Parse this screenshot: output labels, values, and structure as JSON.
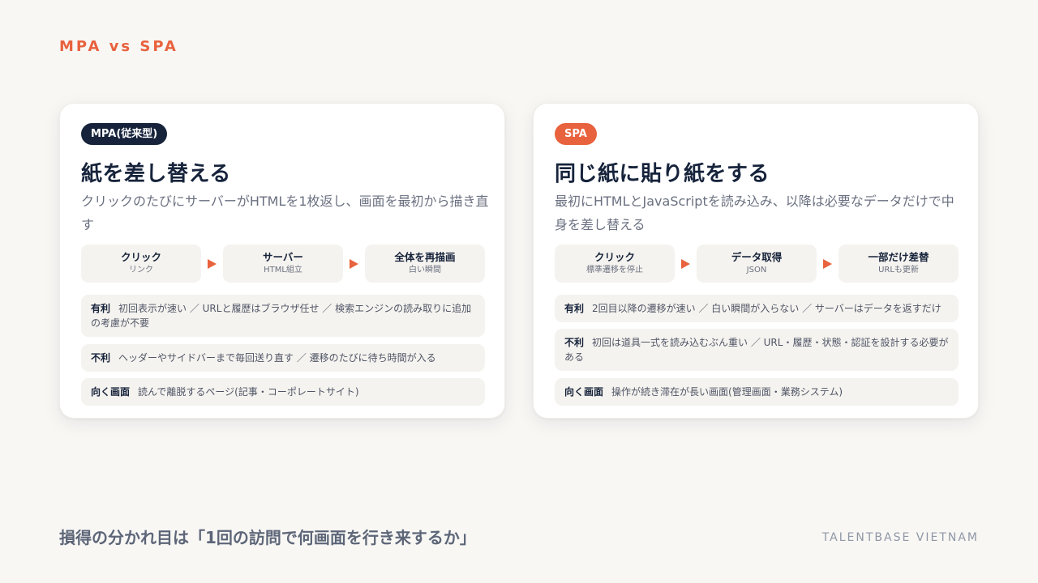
{
  "eyebrow": "MPA vs SPA",
  "mpa": {
    "badge": "MPA(従来型)",
    "title": "紙を差し替える",
    "desc": "クリックのたびにサーバーがHTMLを1枚返し、画面を最初から描き直す",
    "steps": [
      {
        "title": "クリック",
        "sub": "リンク"
      },
      {
        "title": "サーバー",
        "sub": "HTML組立"
      },
      {
        "title": "全体を再描画",
        "sub": "白い瞬間"
      }
    ],
    "rows": [
      {
        "label": "有利",
        "text": "初回表示が速い ／ URLと履歴はブラウザ任せ ／ 検索エンジンの読み取りに追加の考慮が不要"
      },
      {
        "label": "不利",
        "text": "ヘッダーやサイドバーまで毎回送り直す ／ 遷移のたびに待ち時間が入る"
      },
      {
        "label": "向く画面",
        "text": "読んで離脱するページ(記事・コーポレートサイト)"
      }
    ]
  },
  "spa": {
    "badge": "SPA",
    "title": "同じ紙に貼り紙をする",
    "desc": "最初にHTMLとJavaScriptを読み込み、以降は必要なデータだけで中身を差し替える",
    "steps": [
      {
        "title": "クリック",
        "sub": "標準遷移を停止"
      },
      {
        "title": "データ取得",
        "sub": "JSON"
      },
      {
        "title": "一部だけ差替",
        "sub": "URLも更新"
      }
    ],
    "rows": [
      {
        "label": "有利",
        "text": "2回目以降の遷移が速い ／ 白い瞬間が入らない ／ サーバーはデータを返すだけ"
      },
      {
        "label": "不利",
        "text": "初回は道具一式を読み込むぶん重い ／ URL・履歴・状態・認証を設計する必要がある"
      },
      {
        "label": "向く画面",
        "text": "操作が続き滞在が長い画面(管理画面・業務システム)"
      }
    ]
  },
  "footer": {
    "text": "損得の分かれ目は「1回の訪問で何画面を行き来するか」",
    "brand": "TALENTBASE VIETNAM"
  },
  "colors": {
    "accent": "#e8623d",
    "navy": "#16233b",
    "background": "#f8f7f4"
  }
}
